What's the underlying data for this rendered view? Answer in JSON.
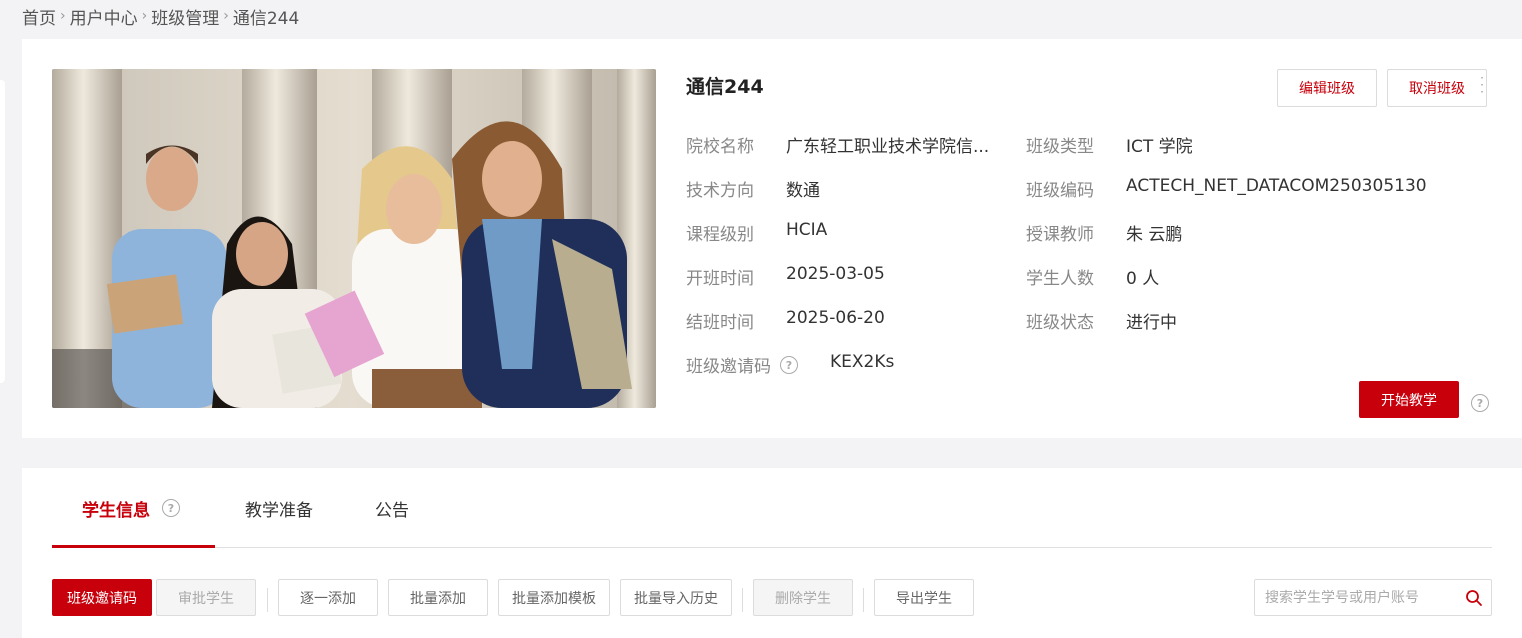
{
  "breadcrumb": [
    "首页",
    "用户中心",
    "班级管理"
  ],
  "breadcrumb_current": "通信244",
  "class": {
    "title": "通信244",
    "school_label": "院校名称",
    "school_value": "广东轻工职业技术学院信...",
    "type_label": "班级类型",
    "type_value": "ICT 学院",
    "tech_label": "技术方向",
    "tech_value": "数通",
    "code_label": "班级编码",
    "code_value": "ACTECH_NET_DATACOM250305130",
    "level_label": "课程级别",
    "level_value": "HCIA",
    "teacher_label": "授课教师",
    "teacher_value": "朱 云鹏",
    "start_label": "开班时间",
    "start_value": "2025-03-05",
    "count_label": "学生人数",
    "count_value": "0 人",
    "end_label": "结班时间",
    "end_value": "2025-06-20",
    "status_label": "班级状态",
    "status_value": "进行中",
    "invite_label": "班级邀请码",
    "invite_value": "KEX2Ks"
  },
  "actions": {
    "edit": "编辑班级",
    "cancel": "取消班级",
    "start": "开始教学"
  },
  "tabs": [
    "学生信息",
    "教学准备",
    "公告"
  ],
  "toolbar": {
    "invite_code": "班级邀请码",
    "review": "审批学生",
    "add_one": "逐一添加",
    "batch_add": "批量添加",
    "batch_template": "批量添加模板",
    "import_history": "批量导入历史",
    "delete": "删除学生",
    "export": "导出学生"
  },
  "search": {
    "placeholder": "搜索学生学号或用户账号"
  },
  "colors": {
    "accent": "#c7000b"
  }
}
